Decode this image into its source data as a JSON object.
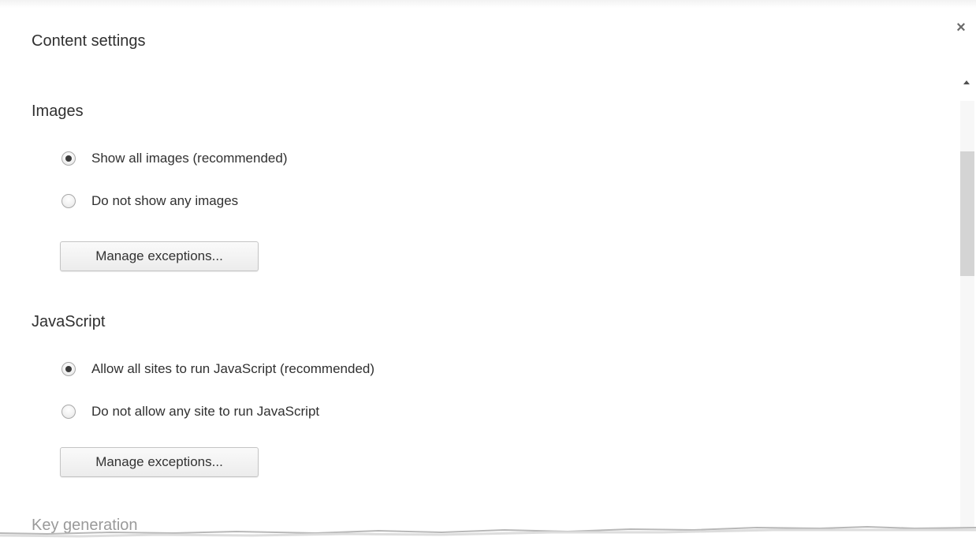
{
  "dialog": {
    "title": "Content settings",
    "close_glyph": "×"
  },
  "images": {
    "heading": "Images",
    "options": [
      {
        "label": "Show all images (recommended)",
        "selected": true
      },
      {
        "label": "Do not show any images",
        "selected": false
      }
    ],
    "manage_button": "Manage exceptions..."
  },
  "javascript": {
    "heading": "JavaScript",
    "options": [
      {
        "label": "Allow all sites to run JavaScript (recommended)",
        "selected": true
      },
      {
        "label": "Do not allow any site to run JavaScript",
        "selected": false
      }
    ],
    "manage_button": "Manage exceptions..."
  },
  "key_generation": {
    "heading": "Key generation"
  },
  "icons": {
    "close": "close-icon",
    "scroll_up": "chevron-up-icon"
  },
  "colors": {
    "text": "#303030",
    "faded_text": "#9a9a9a",
    "scroll_thumb": "#d4d4d4"
  }
}
